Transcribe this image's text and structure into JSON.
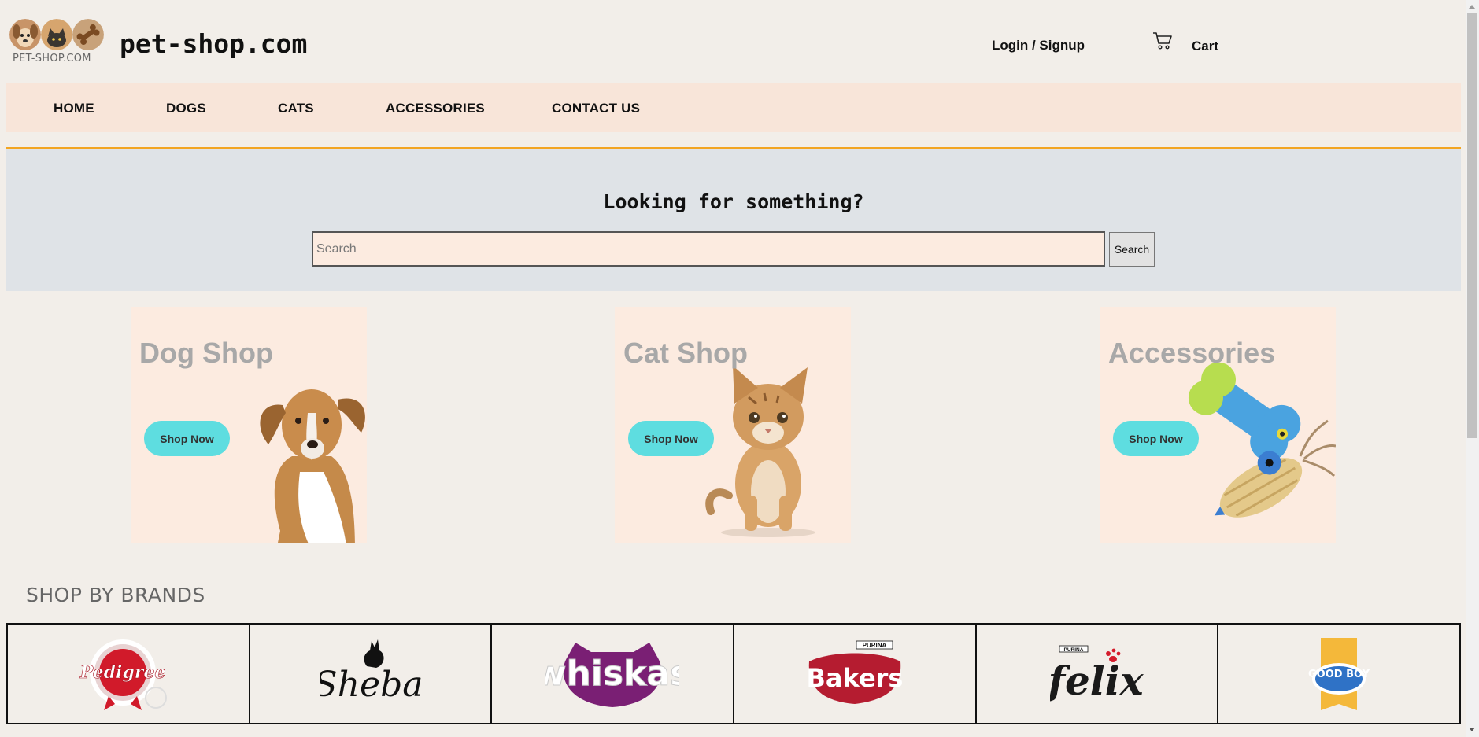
{
  "header": {
    "logo_caption": "PET-SHOP.COM",
    "site_title": "pet-shop.com",
    "login_label": "Login / Signup",
    "cart_label": "Cart"
  },
  "nav": {
    "items": [
      "HOME",
      "DOGS",
      "CATS",
      "ACCESSORIES",
      "CONTACT US"
    ]
  },
  "search": {
    "heading": "Looking for something?",
    "placeholder": "Search",
    "button_label": "Search"
  },
  "cards": [
    {
      "title": "Dog Shop",
      "button_label": "Shop Now"
    },
    {
      "title": "Cat Shop",
      "button_label": "Shop Now"
    },
    {
      "title": "Accessories",
      "button_label": "Shop Now"
    }
  ],
  "brands": {
    "heading": "SHOP BY BRANDS",
    "items": [
      "Pedigree",
      "Sheba",
      "whiskas",
      "Bakers",
      "felix",
      "GOOD BOY"
    ],
    "purina_tag": "PURINA"
  },
  "colors": {
    "background": "#f2eee9",
    "nav_background": "#f8e5d9",
    "nav_rule": "#f2a522",
    "search_band": "#dfe3e7",
    "card_background": "#fcebe0",
    "shop_button": "#5edde0"
  }
}
